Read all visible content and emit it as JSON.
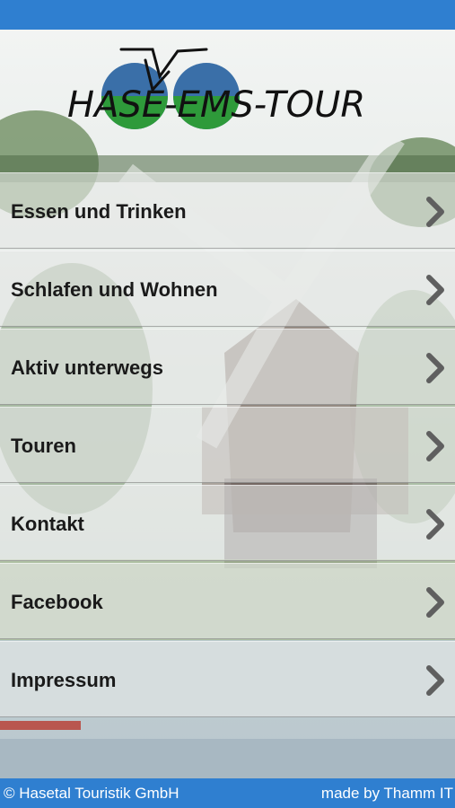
{
  "app": {
    "logo_text": "HASE-EMS-TOUR"
  },
  "menu": {
    "items": [
      {
        "label": "Essen und Trinken",
        "icon": "chevron-right-icon"
      },
      {
        "label": "Schlafen und Wohnen",
        "icon": "chevron-right-icon"
      },
      {
        "label": "Aktiv unterwegs",
        "icon": "chevron-right-icon"
      },
      {
        "label": "Touren",
        "icon": "chevron-right-icon"
      },
      {
        "label": "Kontakt",
        "icon": "chevron-right-icon"
      },
      {
        "label": "Facebook",
        "icon": "chevron-right-icon"
      },
      {
        "label": "Impressum",
        "icon": "chevron-right-icon"
      }
    ]
  },
  "footer": {
    "copyright": "© Hasetal Touristik GmbH",
    "credit": "made by Thamm IT"
  },
  "colors": {
    "bar": "#2f7fd0",
    "logo_blue": "#3a6fa8",
    "logo_green": "#2e9a3a"
  }
}
